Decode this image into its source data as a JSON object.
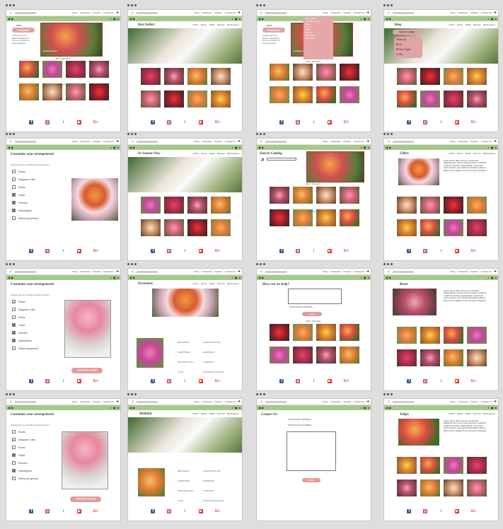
{
  "nav": {
    "shop": "Shop",
    "occasions": "Occasions",
    "flowers": "Flowers",
    "contact": "Contact Us",
    "logo": "Design"
  },
  "categories": [
    "Lillies",
    "Roses",
    "Tulips",
    "Peonies",
    "Hydrangeas"
  ],
  "labels": {
    "best_sellers": "BEST SELLERS",
    "occasions_caps": "OCCASIONS",
    "best_sellers_title": "Best Sellers",
    "in_season": "In Season Now",
    "search_catalog": "Search Catalog",
    "shop": "Shop",
    "occasions_title": "Occasions",
    "birthday": "Birthday",
    "how_help": "How can we help?",
    "contact_us": "Contact Us",
    "lillies": "Lillies",
    "roses": "Roses",
    "tulips": "Tulips",
    "start": "Start",
    "customize": "Customize!",
    "customize_sub": "Create your own flower arrangement from our currently in stock selection!",
    "in_season_now": "In Season Now!",
    "customize_arrangement": "Customize your arrangement!",
    "choose_from": "Choose from our currently in-stock inventory",
    "order_now": "ORDER NOW",
    "filter_by": "Filter by:",
    "price": "Price",
    "flower_type": "Flower Type",
    "color": "Color",
    "enter_email": "ENTER EMAIL ADDRESS",
    "enter_phone": "ENTER PHONE NUMBER",
    "send": "SEND",
    "lorem": "Lorem ipsum dolor sit amet, consectetur adipiscing elit, sed do eiusmod tempor incididunt ut labore et dolore magna aliqua. Ut enim ad minim veniam, quis nostrud exercitation ullamco laboris nisi ut aliquip ex ea commodo consequat."
  },
  "flowers_list": [
    "Roses",
    "Stargazer Lilies",
    "Mums",
    "Tulips",
    "Peonies",
    "Hydrangeas",
    "Filters and greens"
  ],
  "occasions_list": [
    "BIRTHDAYS",
    "VALENTINE'S DAY",
    "CHRISTMAS",
    "WEDDINGS",
    "MOTHER'S DAY",
    "SYMPATHY",
    "LOVE",
    "CONGRATULATIONS"
  ],
  "dropdown": [
    "Best Sellers",
    "In Season Now",
    "Lillies",
    "Roses",
    "Tulips",
    "Peonies",
    "Hydrangeas",
    "All Flowers"
  ],
  "social": [
    "f",
    "◎",
    "t",
    "▶",
    "G+"
  ]
}
